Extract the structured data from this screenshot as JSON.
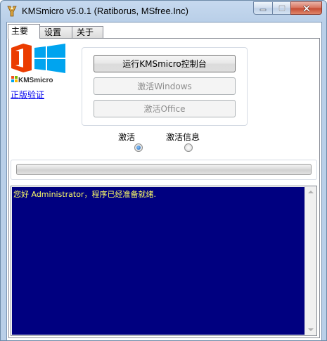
{
  "window": {
    "title": "KMSmicro v5.0.1 (Ratiborus, MSfree.Inc)"
  },
  "tabs": [
    {
      "label": "主要"
    },
    {
      "label": "设置"
    },
    {
      "label": "关于"
    }
  ],
  "logo": {
    "brand_text": "KMSmicro",
    "colors": {
      "office": "#eb3c00",
      "windows": "#00a4ef"
    }
  },
  "verify_link": "正版验证",
  "buttons": {
    "console": "运行KMSmicro控制台",
    "activate_windows": "激活Windows",
    "activate_office": "激活Office"
  },
  "radios": {
    "activate": {
      "label": "激活",
      "checked": true
    },
    "info": {
      "label": "激活信息",
      "checked": false
    }
  },
  "progress": {
    "value_percent": 0
  },
  "console": {
    "text": "您好 Administrator，程序已经准备就绪.",
    "background": "#000080",
    "text_color": "#ffff66"
  }
}
